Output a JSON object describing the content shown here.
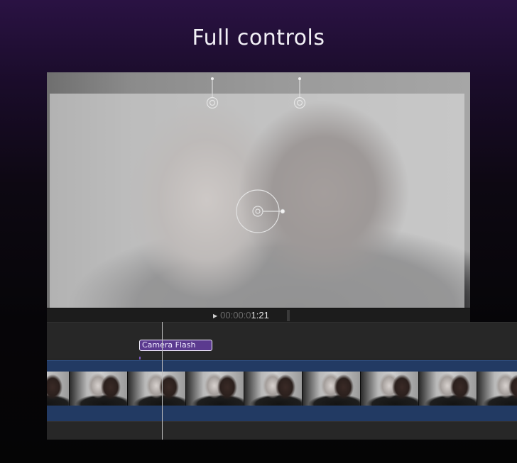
{
  "headline": "Full controls",
  "viewer": {
    "timecode_dim": "00:00:0",
    "timecode_bright": "1:21",
    "play_glyph": "▶"
  },
  "timeline": {
    "title_clip_label": "Camera Flash",
    "clip_count": 9
  },
  "colors": {
    "title_clip": "#5b3a8f",
    "storyline": "#1e3152",
    "playhead": "#bfbfbf"
  },
  "icons": [
    "position-handle-icon",
    "center-target-icon",
    "rotation-handle-icon",
    "play-icon",
    "audio-meter-icon"
  ]
}
